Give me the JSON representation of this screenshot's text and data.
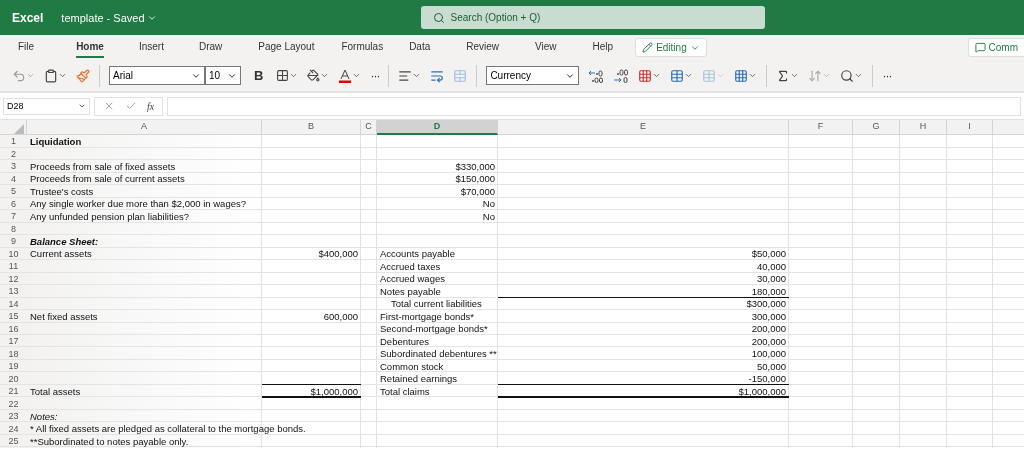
{
  "app": {
    "name": "Excel",
    "document": "template - Saved",
    "search_placeholder": "Search (Option + Q)"
  },
  "ribbon_tabs": [
    {
      "label": "File",
      "selected": false
    },
    {
      "label": "Home",
      "selected": true
    },
    {
      "label": "Insert",
      "selected": false
    },
    {
      "label": "Draw",
      "selected": false
    },
    {
      "label": "Page Layout",
      "selected": false
    },
    {
      "label": "Formulas",
      "selected": false
    },
    {
      "label": "Data",
      "selected": false
    },
    {
      "label": "Review",
      "selected": false
    },
    {
      "label": "View",
      "selected": false
    },
    {
      "label": "Help",
      "selected": false
    }
  ],
  "mode_button": "Editing",
  "comments_button": "Comm",
  "toolbar": {
    "font": "Arial",
    "font_size": "10",
    "bold": "B",
    "more": "···",
    "number_format": "Currency",
    "overflow": "···"
  },
  "formula_bar": {
    "name_box": "D28",
    "fx": "fx"
  },
  "columns": [
    {
      "label": "A",
      "selected": false
    },
    {
      "label": "B",
      "selected": false
    },
    {
      "label": "C",
      "selected": false
    },
    {
      "label": "D",
      "selected": true
    },
    {
      "label": "E",
      "selected": false
    },
    {
      "label": "F",
      "selected": false
    },
    {
      "label": "G",
      "selected": false
    },
    {
      "label": "H",
      "selected": false
    },
    {
      "label": "I",
      "selected": false
    }
  ],
  "rows": [
    {
      "number": "1",
      "kind": "title",
      "A": "Liquidation",
      "underline_b": false,
      "underline_e": false
    },
    {
      "number": "2",
      "kind": "line",
      "underline_b": false,
      "underline_e": false
    },
    {
      "number": "3",
      "kind": "input",
      "A": "Proceeds from sale of fixed assets",
      "D": "$330,000",
      "underline_b": false,
      "underline_e": false
    },
    {
      "number": "4",
      "kind": "input",
      "A": "Proceeds from sale of current assets",
      "D": "$150,000",
      "underline_b": false,
      "underline_e": false
    },
    {
      "number": "5",
      "kind": "input",
      "A": "Trustee's costs",
      "D": "$70,000",
      "underline_b": false,
      "underline_e": false
    },
    {
      "number": "6",
      "kind": "input",
      "A": "Any single worker due more than $2,000 in wages?",
      "D": "No",
      "underline_b": false,
      "underline_e": false
    },
    {
      "number": "7",
      "kind": "input",
      "A": "Any unfunded pension plan liabilities?",
      "D": "No",
      "underline_b": false,
      "underline_e": false
    },
    {
      "number": "8",
      "kind": "line",
      "underline_b": false,
      "underline_e": false
    },
    {
      "number": "9",
      "kind": "section",
      "A": "Balance Sheet:",
      "underline_b": false,
      "underline_e": false
    },
    {
      "number": "10",
      "kind": "line",
      "A": "Current assets",
      "B": "$400,000",
      "D": "Accounts payable",
      "E": "$50,000",
      "underline_b": false,
      "underline_e": false
    },
    {
      "number": "11",
      "kind": "line",
      "D": "Accrued taxes",
      "E": "40,000",
      "underline_b": false,
      "underline_e": false
    },
    {
      "number": "12",
      "kind": "line",
      "D": "Accrued wages",
      "E": "30,000",
      "underline_b": false,
      "underline_e": false
    },
    {
      "number": "13",
      "kind": "line",
      "D": "Notes payable",
      "E": "180,000",
      "underline_b": false,
      "underline_e": true
    },
    {
      "number": "14",
      "kind": "subtotal",
      "D": "Total current liabilities",
      "E": "$300,000",
      "underline_b": false,
      "underline_e": false
    },
    {
      "number": "15",
      "kind": "line",
      "A": "Net fixed assets",
      "B": "600,000",
      "D": "First-mortgage bonds*",
      "E": "300,000",
      "underline_b": false,
      "underline_e": false
    },
    {
      "number": "16",
      "kind": "line",
      "D": "Second-mortgage bonds*",
      "E": "200,000",
      "underline_b": false,
      "underline_e": false
    },
    {
      "number": "17",
      "kind": "line",
      "D": "Debentures",
      "E": "200,000",
      "underline_b": false,
      "underline_e": false
    },
    {
      "number": "18",
      "kind": "line",
      "D": "Subordinated debentures **",
      "E": "100,000",
      "underline_b": false,
      "underline_e": false
    },
    {
      "number": "19",
      "kind": "line",
      "D": "Common stock",
      "E": "50,000",
      "underline_b": false,
      "underline_e": false
    },
    {
      "number": "20",
      "kind": "line",
      "D": "Retained earnings",
      "E": "-150,000",
      "underline_b": true,
      "underline_e": true
    },
    {
      "number": "21",
      "kind": "total",
      "A": "Total assets",
      "B": "$1,000,000",
      "D": "Total claims",
      "E": "$1,000,000",
      "underline_b": true,
      "underline_e": true
    },
    {
      "number": "22",
      "kind": "line",
      "underline_b": false,
      "underline_e": false
    },
    {
      "number": "23",
      "kind": "note_heading",
      "A": "Notes:",
      "underline_b": false,
      "underline_e": false
    },
    {
      "number": "24",
      "kind": "line",
      "A": "* All fixed assets are pledged as collateral to the mortgage bonds.",
      "underline_b": false,
      "underline_e": false
    },
    {
      "number": "25",
      "kind": "line",
      "A": "**Subordinated to notes payable only.",
      "underline_b": false,
      "underline_e": false
    }
  ]
}
